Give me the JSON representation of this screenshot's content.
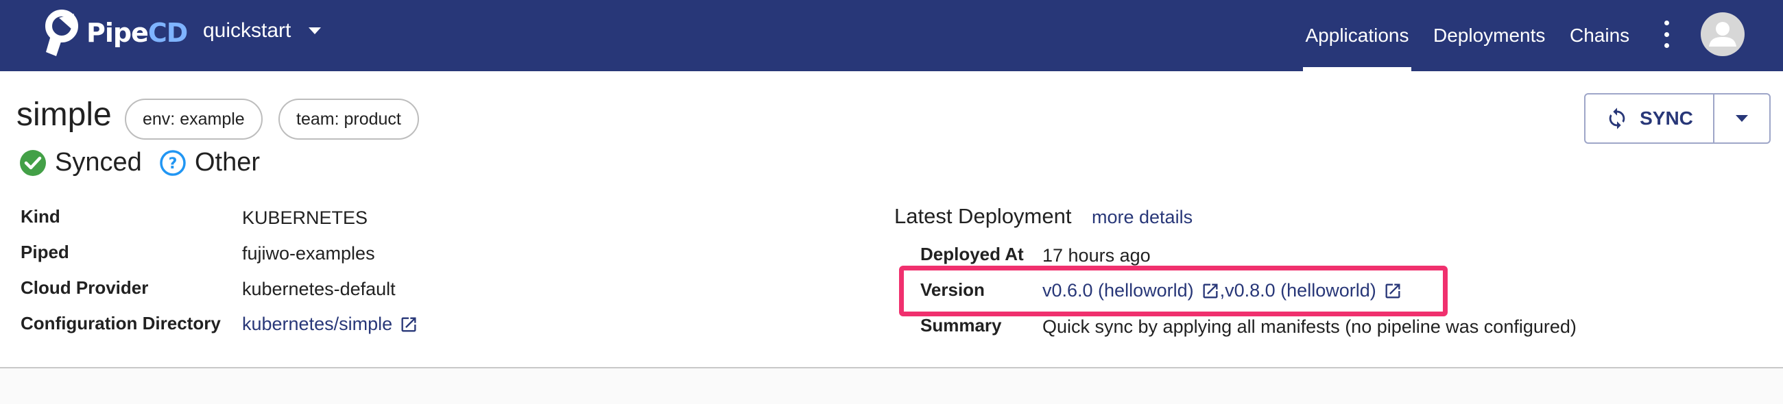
{
  "header": {
    "brand_part1": "Pipe",
    "brand_part2": "CD",
    "project": "quickstart",
    "nav": [
      "Applications",
      "Deployments",
      "Chains"
    ],
    "active_nav": "Applications"
  },
  "app": {
    "name": "simple",
    "labels": [
      "env: example",
      "team: product"
    ],
    "sync_status": "Synced",
    "health_status": "Other",
    "sync_button": "SYNC"
  },
  "details": {
    "kind_label": "Kind",
    "kind_value": "KUBERNETES",
    "piped_label": "Piped",
    "piped_value": "fujiwo-examples",
    "cloud_label": "Cloud Provider",
    "cloud_value": "kubernetes-default",
    "config_label": "Configuration Directory",
    "config_value": "kubernetes/simple"
  },
  "latest": {
    "title": "Latest Deployment",
    "more": "more details",
    "deployed_label": "Deployed At",
    "deployed_value": "17 hours ago",
    "version_label": "Version",
    "version1": "v0.6.0 (helloworld)",
    "version_sep": ",",
    "version2": "v0.8.0 (helloworld)",
    "summary_label": "Summary",
    "summary_value": "Quick sync by applying all manifests (no pipeline was configured)"
  },
  "icons": {
    "synced": "check-circle-icon",
    "other": "help-circle-icon",
    "sync": "sync-icon",
    "external": "external-link-icon"
  },
  "colors": {
    "header_bg": "#283778",
    "link": "#283778",
    "synced_green": "#43a047",
    "help_blue": "#2196f3",
    "highlight": "#f0306e"
  }
}
